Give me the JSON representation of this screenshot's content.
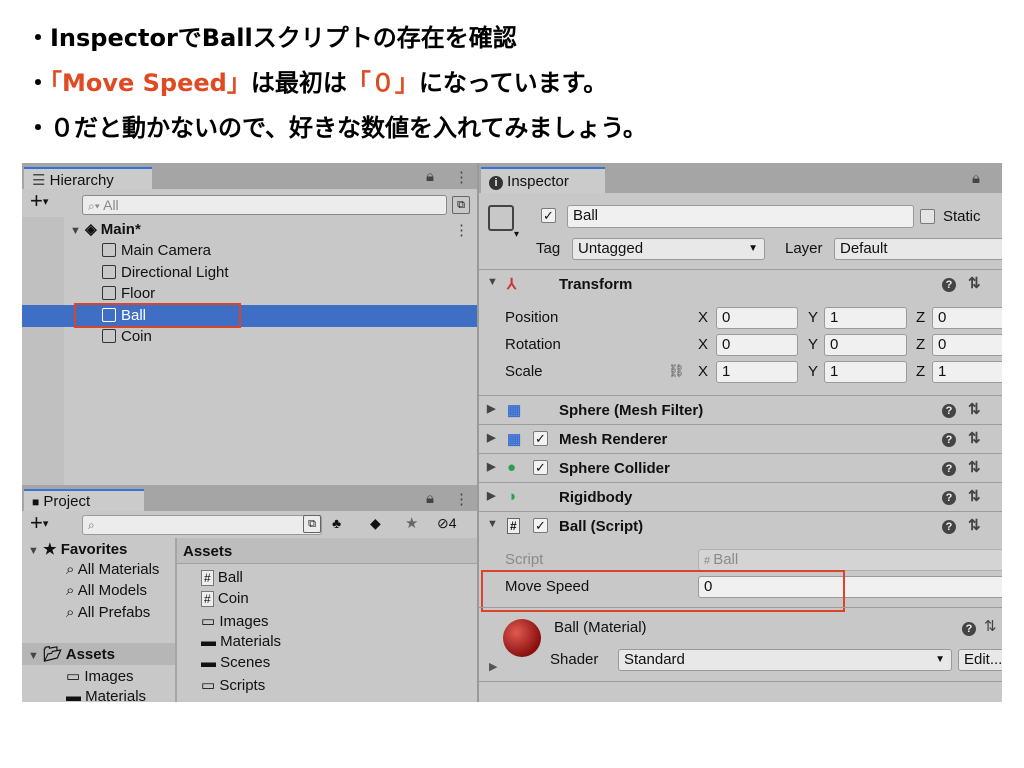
{
  "bullets": {
    "line1": "・InspectorでBallスクリプトの存在を確認",
    "line2_pre": "・",
    "line2_red": "「Move Speed」",
    "line2_mid": "は最初は",
    "line2_red2": "「０」",
    "line2_post": "になっています。",
    "line3": "・０だと動かないので、好きな数値を入れてみましょう。"
  },
  "hierarchy": {
    "tab_label": "Hierarchy",
    "search_placeholder": "All",
    "scene_name": "Main*",
    "items": [
      "Main Camera",
      "Directional Light",
      "Floor",
      "Ball",
      "Coin"
    ],
    "selected_index": 3
  },
  "project": {
    "tab_label": "Project",
    "hidden_count": "4",
    "favorites_label": "Favorites",
    "favorites": [
      "All Materials",
      "All Models",
      "All Prefabs"
    ],
    "assets_label": "Assets",
    "assets_tree": [
      "Images",
      "Materials"
    ],
    "assets_header": "Assets",
    "assets_items": [
      {
        "icon": "script",
        "label": "Ball"
      },
      {
        "icon": "script",
        "label": "Coin"
      },
      {
        "icon": "folder-empty",
        "label": "Images"
      },
      {
        "icon": "folder",
        "label": "Materials"
      },
      {
        "icon": "folder",
        "label": "Scenes"
      },
      {
        "icon": "folder-empty",
        "label": "Scripts"
      }
    ]
  },
  "inspector": {
    "tab_label": "Inspector",
    "object_name": "Ball",
    "static_label": "Static",
    "tag_label": "Tag",
    "tag_value": "Untagged",
    "layer_label": "Layer",
    "layer_value": "Default",
    "transform": {
      "title": "Transform",
      "rows": [
        {
          "label": "Position",
          "x": "0",
          "y": "1",
          "z": "0"
        },
        {
          "label": "Rotation",
          "x": "0",
          "y": "0",
          "z": "0"
        },
        {
          "label": "Scale",
          "x": "1",
          "y": "1",
          "z": "1"
        }
      ]
    },
    "components": [
      "Sphere (Mesh Filter)",
      "Mesh Renderer",
      "Sphere Collider",
      "Rigidbody",
      "Ball (Script)"
    ],
    "script_label": "Script",
    "script_value": "Ball",
    "move_speed_label": "Move Speed",
    "move_speed_value": "0",
    "material_name": "Ball (Material)",
    "shader_label": "Shader",
    "shader_value": "Standard",
    "edit_label": "Edit...",
    "axis_labels": {
      "x": "X",
      "y": "Y",
      "z": "Z"
    }
  },
  "colors": {
    "highlight": "#d8452c",
    "selection": "#3a72d6",
    "red_text": "#e04a22"
  }
}
